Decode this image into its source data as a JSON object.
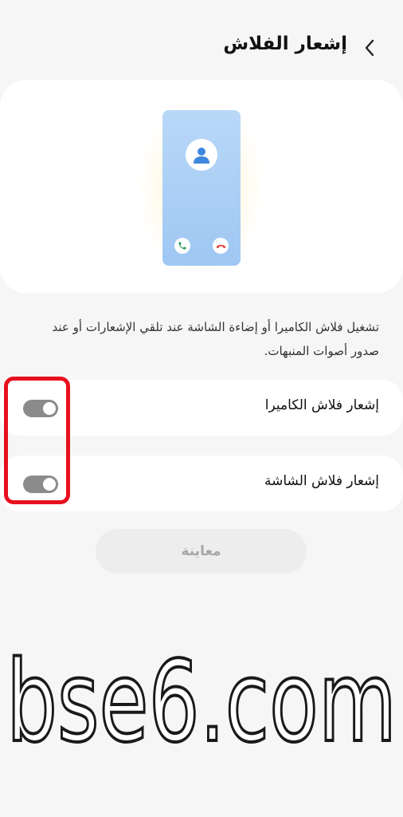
{
  "header": {
    "title": "إشعار الفلاش",
    "back_icon": "chevron-left-icon"
  },
  "preview": {
    "avatar_icon": "person-icon",
    "accept_icon": "phone-accept-icon",
    "decline_icon": "phone-decline-icon"
  },
  "description": "تشغيل فلاش الكاميرا أو إضاءة الشاشة عند تلقي الإشعارات أو عند صدور أصوات المنبهات.",
  "settings": [
    {
      "label": "إشعار فلاش الكاميرا",
      "enabled": false
    },
    {
      "label": "إشعار فلاش الشاشة",
      "enabled": false
    }
  ],
  "preview_button": "معاينة",
  "watermark": "bse6.com",
  "colors": {
    "highlight": "#e8101d",
    "toggle_off": "#8b8b8b",
    "phone_screen": "#a9cdf5",
    "accept": "#2e9c54",
    "decline": "#e03a2f"
  }
}
